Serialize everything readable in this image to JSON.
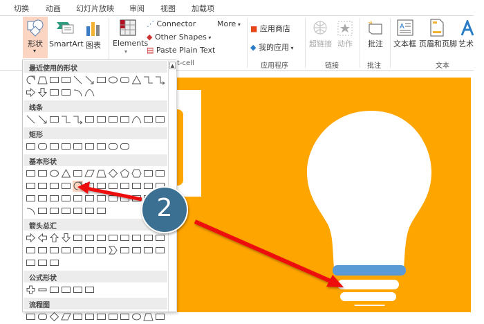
{
  "tabs": [
    "切换",
    "动画",
    "幻灯片放映",
    "审阅",
    "视图",
    "加载项"
  ],
  "ribbon": {
    "shapes": "形状",
    "smartart": "SmartArt",
    "chart": "图表",
    "elements": "Elements",
    "connector": "Connector",
    "other_shapes": "Other Shapes",
    "paste_plain": "Paste Plain Text",
    "more": "More",
    "app_store": "应用商店",
    "my_apps": "我的应用",
    "hyperlink": "超链接",
    "action": "动作",
    "comment": "批注",
    "textbox": "文本框",
    "header_footer": "页眉和页脚",
    "wordart": "艺术",
    "groups": {
      "cell": "t-cell",
      "apps": "应用程序",
      "links": "链接",
      "comments": "批注",
      "text": "文本"
    }
  },
  "gallery": {
    "sections": [
      {
        "title": "最近使用的形状",
        "rows": [
          [
            "teardrop",
            "trapezoid",
            "textbox",
            "vtextbox",
            "line",
            "arrow-line",
            "rect",
            "ellipse",
            "roundrect",
            "triangle",
            "elbow",
            "elbow-arrow"
          ],
          [
            "right-arrow",
            "down-arrow",
            "freeform",
            "scribble",
            "arc",
            "curve"
          ]
        ]
      },
      {
        "title": "线条",
        "rows": [
          [
            "line",
            "arrow-line",
            "double-arrow-line",
            "elbow",
            "elbow-arrow",
            "elbow-double",
            "curve-connector",
            "curve-arrow",
            "curve-double",
            "curve",
            "freeform",
            "scribble"
          ]
        ]
      },
      {
        "title": "矩形",
        "rows": [
          [
            "rect",
            "roundrect",
            "snip-rect",
            "round-top",
            "snip-round",
            "snip2",
            "round2",
            "roundrect",
            "roundrect"
          ]
        ]
      },
      {
        "title": "基本形状",
        "rows": [
          [
            "textbox",
            "vtextbox",
            "ellipse",
            "triangle",
            "right-triangle",
            "parallelogram",
            "trapezoid",
            "diamond",
            "pentagon",
            "hexagon",
            "heptagon",
            "octagon"
          ],
          [
            "decagon",
            "dodecagon",
            "pie",
            "chord",
            "teardrop",
            "frame",
            "half-frame",
            "l-shape",
            "diagonal-stripe",
            "cross",
            "plaque",
            "can"
          ],
          [
            "cube",
            "bevel",
            "donut",
            "no-symbol",
            "block-arc",
            "folded-corner",
            "smiley",
            "heart",
            "lightning",
            "sun",
            "moon",
            "cloud"
          ],
          [
            "arc",
            "double-bracket",
            "double-brace",
            "left-bracket",
            "right-bracket",
            "left-brace",
            "right-brace"
          ]
        ]
      },
      {
        "title": "箭头总汇",
        "rows": [
          [
            "right-arrow",
            "left-arrow",
            "up-arrow",
            "down-arrow",
            "left-right-arrow",
            "up-down-arrow",
            "quad-arrow",
            "left-right-up-arrow",
            "bent-arrow",
            "u-turn-arrow",
            "left-up-arrow",
            "bent-up-arrow"
          ],
          [
            "curved-right-arrow",
            "curved-left-arrow",
            "curved-up-arrow",
            "curved-down-arrow",
            "striped-right-arrow",
            "notched-right-arrow",
            "pentagon-arrow",
            "chevron",
            "right-arrow-callout",
            "down-arrow-callout",
            "left-arrow-callout",
            "up-arrow-callout"
          ],
          [
            "left-right-arrow-callout",
            "quad-arrow-callout",
            "circular-arrow"
          ]
        ]
      },
      {
        "title": "公式形状",
        "rows": [
          [
            "plus",
            "minus",
            "multiply",
            "divide",
            "equal",
            "not-equal"
          ]
        ]
      },
      {
        "title": "流程图",
        "rows": [
          [
            "rect",
            "roundrect",
            "diamond",
            "parallelogram",
            "rect",
            "rect",
            "document",
            "multidocument",
            "terminator",
            "ellipse",
            "trapezoid",
            "merge"
          ]
        ]
      }
    ],
    "highlighted": "teardrop"
  },
  "callout": {
    "number": "2",
    "color": "#3b6f93"
  },
  "colors": {
    "slide": "#ffa500",
    "accent_blue": "#5b9bd5",
    "arrow": "#ee1111",
    "shapes_highlight": "#fbd5c2"
  }
}
